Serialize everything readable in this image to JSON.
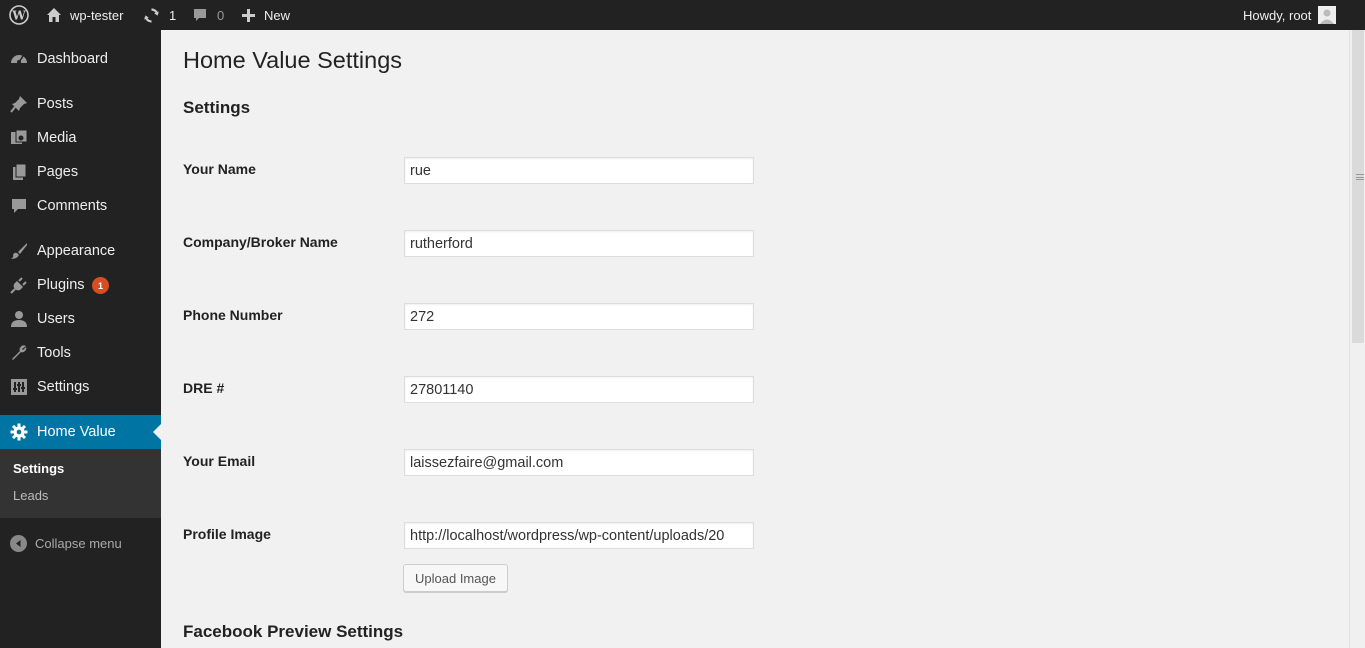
{
  "adminbar": {
    "site_name": "wp-tester",
    "updates_count": "1",
    "comments_count": "0",
    "new_label": "New",
    "howdy": "Howdy, root",
    "icons": [
      "wordpress-logo-icon",
      "home-icon",
      "updates-icon",
      "comment-bubble-icon",
      "plus-icon",
      "avatar"
    ]
  },
  "menu": {
    "items": [
      {
        "label": "Dashboard",
        "icon": "dashboard-icon"
      },
      {
        "label": "Posts",
        "icon": "pushpin-icon"
      },
      {
        "label": "Media",
        "icon": "media-icon"
      },
      {
        "label": "Pages",
        "icon": "pages-icon"
      },
      {
        "label": "Comments",
        "icon": "comment-icon"
      },
      {
        "label": "Appearance",
        "icon": "brush-icon"
      },
      {
        "label": "Plugins",
        "icon": "plugin-icon",
        "badge": "1"
      },
      {
        "label": "Users",
        "icon": "user-icon"
      },
      {
        "label": "Tools",
        "icon": "wrench-icon"
      },
      {
        "label": "Settings",
        "icon": "settings-sliders-icon"
      },
      {
        "label": "Home Value",
        "icon": "gear-icon",
        "current": true
      }
    ],
    "submenu": [
      "Settings",
      "Leads"
    ],
    "collapse_label": "Collapse menu"
  },
  "page": {
    "title": "Home Value Settings",
    "section_title": "Settings",
    "fields": [
      {
        "label": "Your Name",
        "value": "rue"
      },
      {
        "label": "Company/Broker Name",
        "value": "rutherford"
      },
      {
        "label": "Phone Number",
        "value": "272"
      },
      {
        "label": "DRE #",
        "value": "27801140"
      },
      {
        "label": "Your Email",
        "value": "laissezfaire@gmail.com"
      },
      {
        "label": "Profile Image",
        "value": "http://localhost/wordpress/wp-content/uploads/20"
      }
    ],
    "upload_button": "Upload Image",
    "facebook_section_title": "Facebook Preview Settings"
  },
  "colors": {
    "adminbar_bg": "#222222",
    "menu_bg": "#222222",
    "menu_current_bg": "#0074a2",
    "badge_bg": "#d54e21",
    "content_bg": "#f1f1f1"
  }
}
